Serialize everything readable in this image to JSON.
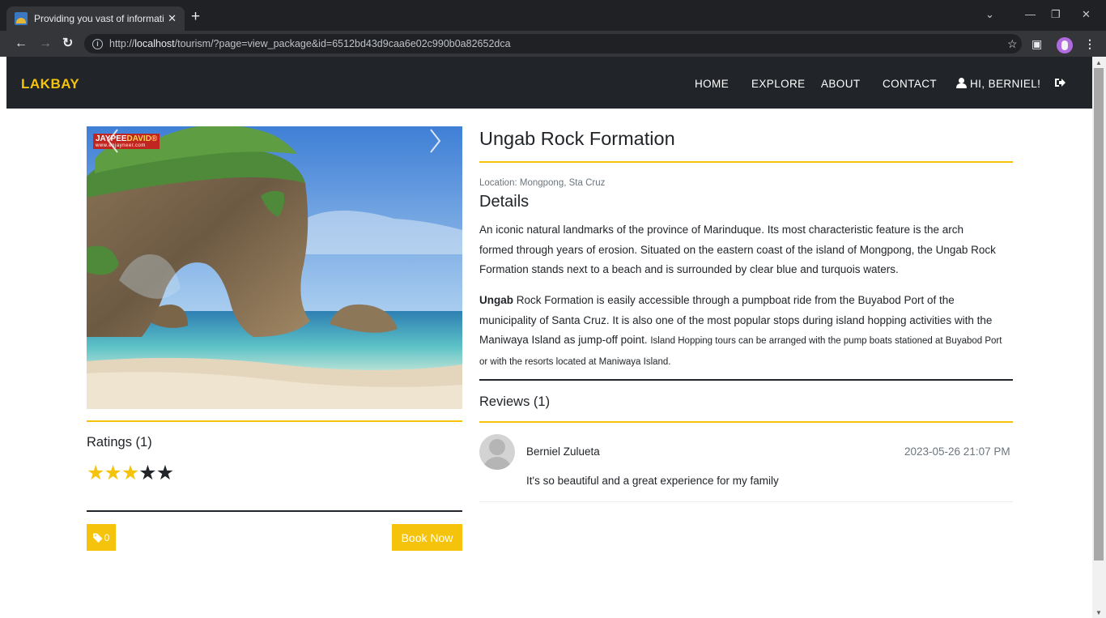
{
  "browser": {
    "tab_title": "Providing you vast of informatio",
    "tab_close": "✕",
    "new_tab": "+",
    "url_prefix": "http://",
    "url_host": "localhost",
    "url_path": "/tourism/?page=view_package&id=6512bd43d9caa6e02c990b0a82652dca",
    "icons": [
      "back-icon",
      "forward-icon",
      "reload-icon",
      "info-icon",
      "share-icon",
      "star-icon",
      "sidepanel-icon",
      "profile-icon",
      "menu-icon"
    ]
  },
  "navbar": {
    "brand": "LAKBAY",
    "links": [
      "HOME",
      "EXPLORE",
      "ABOUT",
      "CONTACT"
    ],
    "user_greeting": "HI, BERNIEL!"
  },
  "hero": {
    "watermark_a": "JAYPEE",
    "watermark_b": "DAVID®",
    "watermark_sub": "www.enjayneer.com"
  },
  "ratings": {
    "title": "Ratings (1)",
    "value": 3,
    "max": 5
  },
  "actions": {
    "tag_count": "0",
    "book_label": "Book Now"
  },
  "package": {
    "title": "Ungab Rock Formation",
    "location": "Location: Mongpong, Sta Cruz",
    "details_title": "Details",
    "desc1": "An iconic natural landmarks of the province of Marinduque. Its most characteristic feature is the arch formed through years of erosion. Situated on the eastern coast of the island of Mongpong, the Ungab Rock Formation stands next to a beach and is surrounded by clear blue and turquois waters.",
    "desc2_bold": "Ungab",
    "desc2_main": " Rock Formation is easily accessible through a pumpboat ride from the Buyabod Port of the municipality of Santa Cruz. It is also one of the most popular stops during island hopping activities with the Maniwaya Island as jump-off point. ",
    "desc2_small": "Island Hopping tours can be arranged with the pump boats stationed at Buyabod Port or with the resorts located at Maniwaya Island."
  },
  "reviews": {
    "title": "Reviews (1)",
    "items": [
      {
        "name": "Berniel Zulueta",
        "date": "2023-05-26 21:07 PM",
        "text": "It's so beautiful and a great experience for my family"
      }
    ]
  },
  "colors": {
    "accent": "#f5c30c",
    "navbar_bg": "#212529",
    "chrome_bg": "#202124"
  }
}
